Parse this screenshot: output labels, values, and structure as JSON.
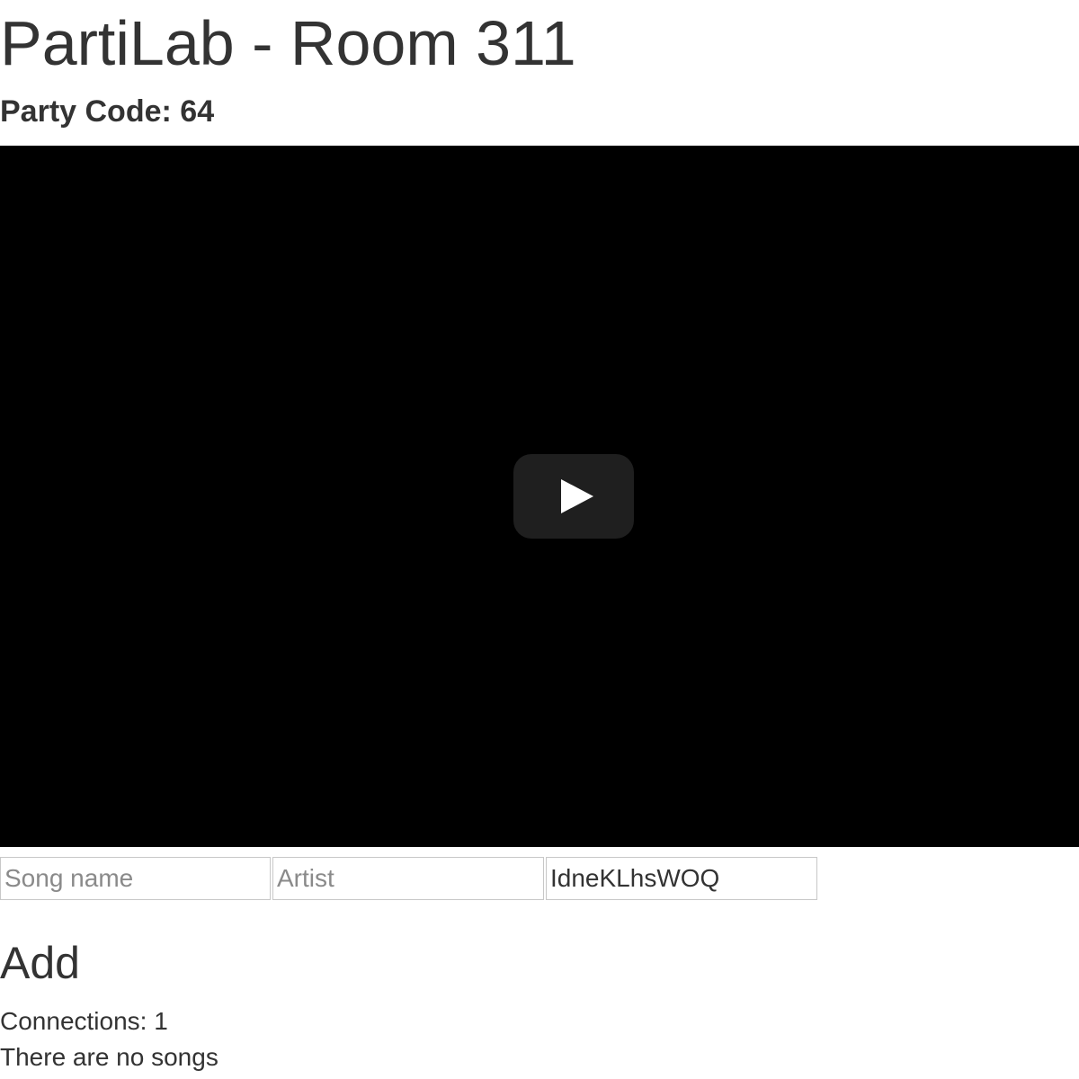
{
  "header": {
    "title": "PartiLab - Room 311",
    "party_code_label": "Party Code:",
    "party_code": "64"
  },
  "player": {
    "play_icon": "play-icon",
    "background_color": "#000000"
  },
  "form": {
    "song_name": {
      "value": "",
      "placeholder": "Song name"
    },
    "artist": {
      "value": "",
      "placeholder": "Artist"
    },
    "video_id": {
      "value": "IdneKLhsWOQ",
      "placeholder": ""
    },
    "add_label": "Add"
  },
  "status": {
    "connections_label": "Connections:",
    "connections_count": "1",
    "songs_message": "There are no songs"
  }
}
